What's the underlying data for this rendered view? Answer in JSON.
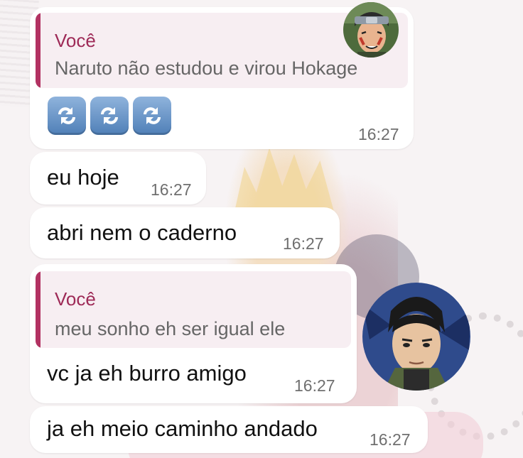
{
  "chat": {
    "messages": [
      {
        "reply": {
          "author": "Você",
          "text": "Naruto não estudou e virou Hokage"
        },
        "emojis": [
          "repeat-icon",
          "repeat-icon",
          "repeat-icon"
        ],
        "time": "16:27"
      },
      {
        "text": "eu hoje",
        "time": "16:27"
      },
      {
        "text": "abri nem o caderno",
        "time": "16:27"
      },
      {
        "reply": {
          "author": "Você",
          "text": "meu sonho eh ser igual ele"
        },
        "text": "vc ja eh burro amigo",
        "time": "16:27"
      },
      {
        "text": "ja eh meio caminho andado",
        "time": "16:27"
      }
    ]
  },
  "colors": {
    "reply_accent": "#b23262",
    "bubble": "#ffffff",
    "time_text": "#6f6f6f"
  }
}
